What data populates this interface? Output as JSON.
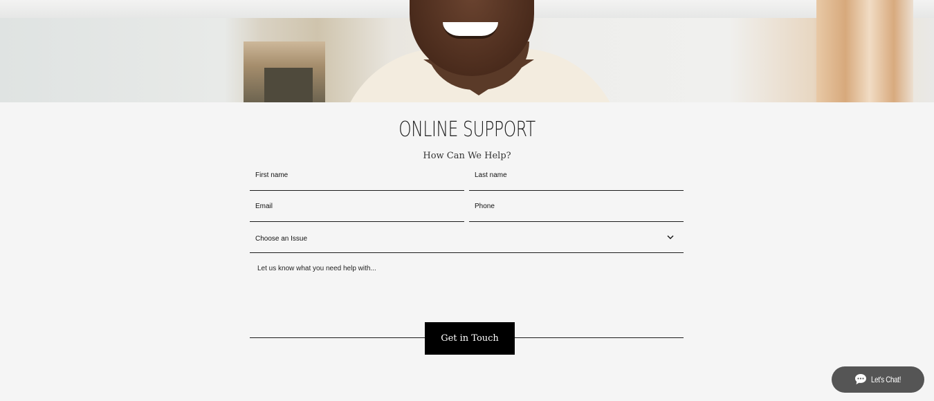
{
  "hero": {
    "image_description": "smiling-person-photo"
  },
  "support": {
    "title": "ONLINE SUPPORT",
    "subtitle": "How Can We Help?"
  },
  "form": {
    "first_name_placeholder": "First name",
    "last_name_placeholder": "Last name",
    "email_placeholder": "Email",
    "phone_placeholder": "Phone",
    "issue_label": "Choose an Issue",
    "message_placeholder": "Let us know what you need help with...",
    "submit_label": "Get in Touch"
  },
  "chat": {
    "label": "Let's Chat!",
    "icon": "chat-bubble-icon"
  },
  "colors": {
    "background": "#f5f5f5",
    "button": "#000000",
    "chat_button": "#555555",
    "text": "#111111"
  }
}
